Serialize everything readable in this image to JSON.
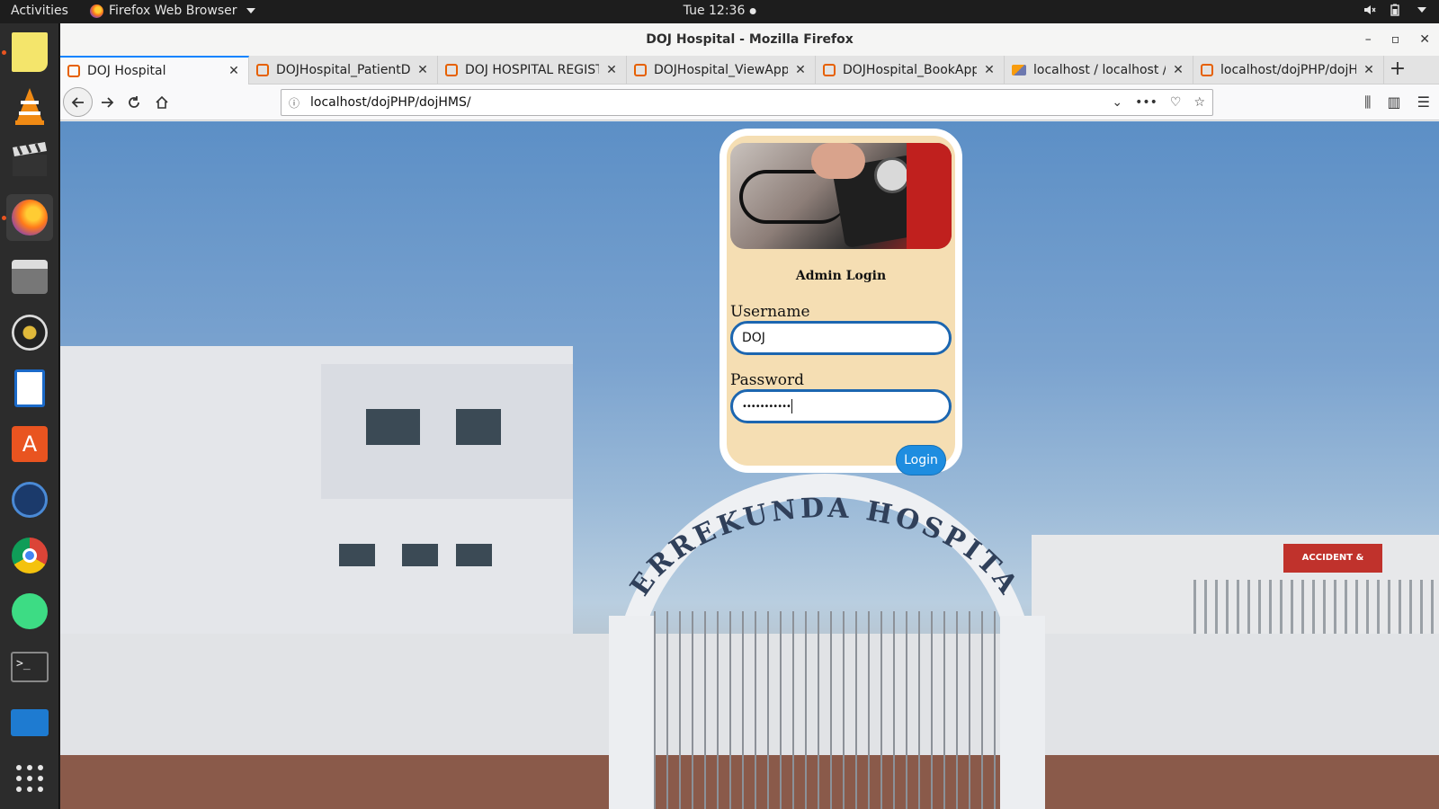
{
  "topbar": {
    "activities": "Activities",
    "app_name": "Firefox Web Browser",
    "clock": "Tue 12:36"
  },
  "dock": {
    "apps": [
      "notes-icon",
      "vlc-icon",
      "clapper-icon",
      "firefox-icon",
      "files-icon",
      "rhythmbox-icon",
      "writer-icon",
      "software-center-icon",
      "video-icon",
      "chrome-icon",
      "android-studio-icon",
      "terminal-icon",
      "monitor-icon",
      "app-grid-icon"
    ]
  },
  "window": {
    "title": "DOJ Hospital - Mozilla Firefox"
  },
  "tabs": [
    {
      "label": "DOJ Hospital",
      "active": true
    },
    {
      "label": "DOJHospital_PatientD",
      "active": false
    },
    {
      "label": "DOJ HOSPITAL REGISTE",
      "active": false
    },
    {
      "label": "DOJHospital_ViewApp",
      "active": false
    },
    {
      "label": "DOJHospital_BookApp",
      "active": false
    },
    {
      "label": "localhost / localhost / h",
      "active": false
    },
    {
      "label": "localhost/dojPHP/dojH",
      "active": false
    }
  ],
  "navbar": {
    "url": "localhost/dojPHP/dojHMS/"
  },
  "login": {
    "heading": "Admin Login",
    "username_label": "Username",
    "username_value": "DOJ",
    "password_label": "Password",
    "password_value": "•••••••••••",
    "button": "Login"
  },
  "background": {
    "sign_text": "SERREKUNDA HOSPITAL",
    "unit_sign": "ACCIDENT & EMERGENCY UNIT"
  }
}
